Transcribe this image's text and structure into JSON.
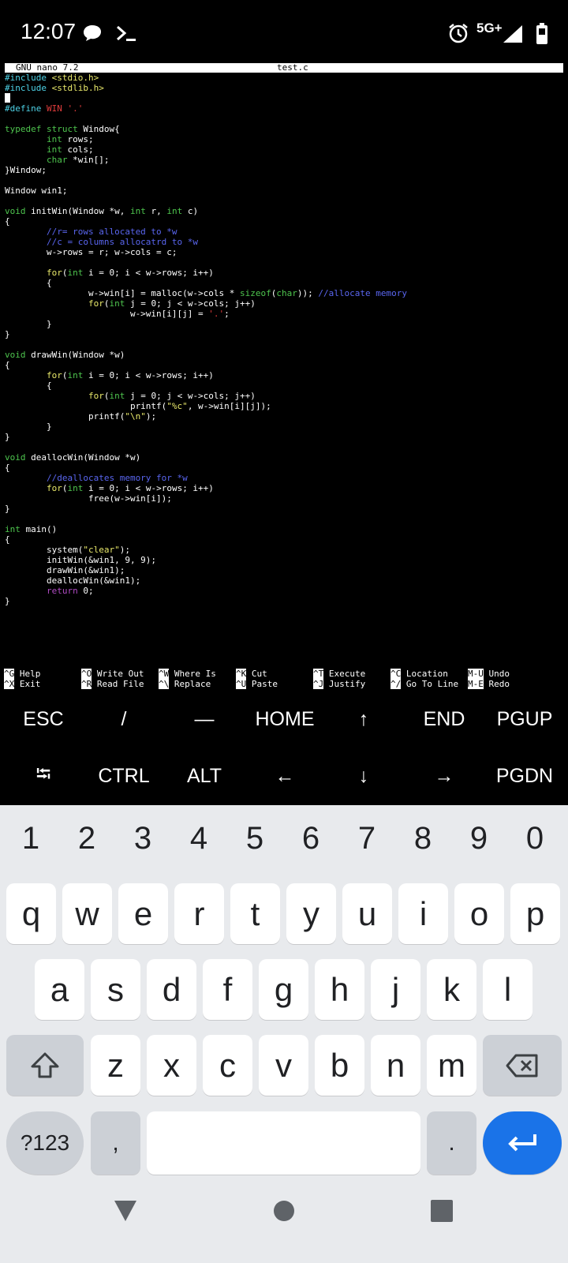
{
  "status_bar": {
    "time": "12:07",
    "network": "5G+",
    "icons": [
      "chat-bubble-icon",
      "terminal-prompt-icon",
      "alarm-icon",
      "signal-icon",
      "battery-icon"
    ]
  },
  "nano": {
    "version": "GNU nano 7.2",
    "filename": "test.c"
  },
  "code_lines": {
    "l1a": "#include ",
    "l1b": "<stdio.h>",
    "l2a": "#include ",
    "l2b": "<stdlib.h>",
    "l4a": "#define ",
    "l4b": "WIN ",
    "l4c": "'.'",
    "l6a": "typedef struct ",
    "l6b": "Window{",
    "l7a": "        int ",
    "l7b": "rows;",
    "l8a": "        int ",
    "l8b": "cols;",
    "l9a": "        char ",
    "l9b": "*win[];",
    "l10": "}Window;",
    "l12": "Window win1;",
    "l14a": "void ",
    "l14b": "initWin(Window *w, ",
    "l14c": "int ",
    "l14d": "r, ",
    "l14e": "int ",
    "l14f": "c)",
    "l15": "{",
    "l16": "        //r= rows allocated to *w",
    "l17": "        //c = columns allocatrd to *w",
    "l18": "        w->rows = r; w->cols = c;",
    "l20a": "        ",
    "l20b": "for",
    "l20c": "(",
    "l20d": "int ",
    "l20e": "i = 0; i < w->rows; i++)",
    "l21": "        {",
    "l22a": "                w->win[i] = malloc(w->cols * ",
    "l22b": "sizeof",
    "l22c": "(",
    "l22d": "char",
    "l22e": ")); ",
    "l22f": "//allocate memory",
    "l23a": "                ",
    "l23b": "for",
    "l23c": "(",
    "l23d": "int ",
    "l23e": "j = 0; j < w->cols; j++)",
    "l24a": "                        w->win[i][j] = ",
    "l24b": "'.'",
    "l24c": ";",
    "l25": "        }",
    "l26": "}",
    "l28a": "void ",
    "l28b": "drawWin(Window *w)",
    "l29": "{",
    "l30a": "        ",
    "l30b": "for",
    "l30c": "(",
    "l30d": "int ",
    "l30e": "i = 0; i < w->rows; i++)",
    "l31": "        {",
    "l32a": "                ",
    "l32b": "for",
    "l32c": "(",
    "l32d": "int ",
    "l32e": "j = 0; j < w->cols; j++)",
    "l33a": "                        printf(",
    "l33b": "\"%c\"",
    "l33c": ", w->win[i][j]);",
    "l34a": "                printf(",
    "l34b": "\"\\n\"",
    "l34c": ");",
    "l35": "        }",
    "l36": "}",
    "l38a": "void ",
    "l38b": "deallocWin(Window *w)",
    "l39": "{",
    "l40": "        //deallocates memory for *w",
    "l41a": "        ",
    "l41b": "for",
    "l41c": "(",
    "l41d": "int ",
    "l41e": "i = 0; i < w->rows; i++)",
    "l42": "                free(w->win[i]);",
    "l43": "}",
    "l45a": "int ",
    "l45b": "main()",
    "l46": "{",
    "l47a": "        system(",
    "l47b": "\"clear\"",
    "l47c": ");",
    "l48": "        initWin(&win1, 9, 9);",
    "l49": "        drawWin(&win1);",
    "l50": "        deallocWin(&win1);",
    "l51a": "        ",
    "l51b": "return ",
    "l51c": "0;",
    "l52": "}"
  },
  "shortcuts": [
    {
      "k1": "^G",
      "l1": " Help",
      "k2": "^X",
      "l2": " Exit"
    },
    {
      "k1": "^O",
      "l1": " Write Out",
      "k2": "^R",
      "l2": " Read File"
    },
    {
      "k1": "^W",
      "l1": " Where Is",
      "k2": "^\\",
      "l2": " Replace"
    },
    {
      "k1": "^K",
      "l1": " Cut",
      "k2": "^U",
      "l2": " Paste"
    },
    {
      "k1": "^T",
      "l1": " Execute",
      "k2": "^J",
      "l2": " Justify"
    },
    {
      "k1": "^C",
      "l1": " Location",
      "k2": "^/",
      "l2": " Go To Line"
    },
    {
      "k1": "M-U",
      "l1": " Undo",
      "k2": "M-E",
      "l2": " Redo"
    }
  ],
  "extra_keys": {
    "row1": [
      "ESC",
      "/",
      "—",
      "HOME",
      "↑",
      "END",
      "PGUP"
    ],
    "row2": [
      "⭾",
      "CTRL",
      "ALT",
      "←",
      "↓",
      "→",
      "PGDN"
    ]
  },
  "keyboard": {
    "numbers": [
      "1",
      "2",
      "3",
      "4",
      "5",
      "6",
      "7",
      "8",
      "9",
      "0"
    ],
    "row1": [
      "q",
      "w",
      "e",
      "r",
      "t",
      "y",
      "u",
      "i",
      "o",
      "p"
    ],
    "row2": [
      "a",
      "s",
      "d",
      "f",
      "g",
      "h",
      "j",
      "k",
      "l"
    ],
    "row3": [
      "z",
      "x",
      "c",
      "v",
      "b",
      "n",
      "m"
    ],
    "symbols_label": "?123",
    "comma": ",",
    "period": "."
  },
  "colors": {
    "accent_blue": "#1a73e8",
    "keyboard_bg": "#e8eaed",
    "comment": "#5a66f0",
    "keyword": "#4ec54e",
    "string": "#e8e86a",
    "preproc": "#4ed2e6"
  }
}
